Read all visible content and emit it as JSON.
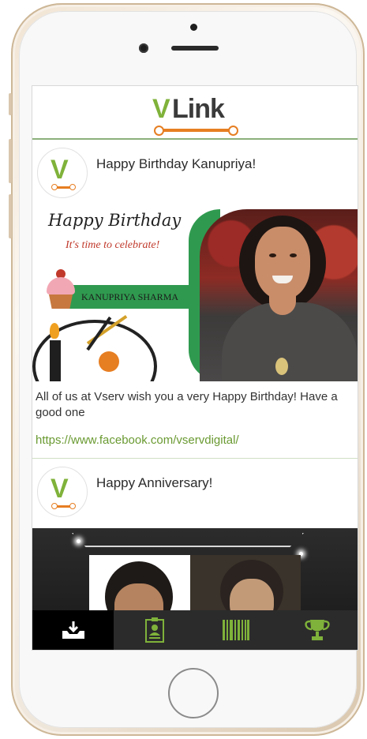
{
  "app": {
    "logo_v": "V",
    "logo_link": "Link"
  },
  "feed": {
    "posts": [
      {
        "title": "Happy Birthday Kanupriya!",
        "image_text": {
          "heading": "Happy Birthday",
          "subheading": "It's time to celebrate!",
          "name": "KANUPRIYA SHARMA"
        },
        "message": "All of us at Vserv wish you a very Happy Birthday! Have a good one",
        "link": "https://www.facebook.com/vservdigital/"
      },
      {
        "title": "Happy Anniversary!"
      }
    ]
  },
  "tabs": [
    {
      "icon": "inbox-download-icon",
      "active": true
    },
    {
      "icon": "contact-card-icon",
      "active": false
    },
    {
      "icon": "barcode-icon",
      "active": false
    },
    {
      "icon": "trophy-icon",
      "active": false
    }
  ],
  "colors": {
    "brand_green": "#7fb23a",
    "brand_orange": "#e67e22",
    "tab_bar": "#2b2b2b",
    "link": "#6a9a32"
  }
}
